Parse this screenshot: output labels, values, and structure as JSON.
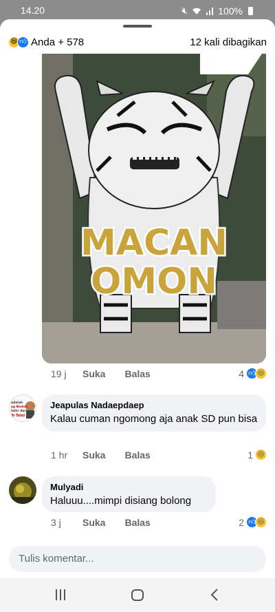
{
  "status": {
    "time": "14.20",
    "battery": "100%"
  },
  "post": {
    "reactors": "Anda + 578",
    "shares": "12 kali dibagikan",
    "meme_caption_line1": "MACAN",
    "meme_caption_line2": "OMON",
    "time": "19 j",
    "like_label": "Suka",
    "reply_label": "Balas",
    "reaction_count": "4"
  },
  "comments": [
    {
      "author": "Jeapulas Nadaepdaep",
      "text": "Kalau cuman ngomong aja anak SD  pun bisa",
      "time": "1 hr",
      "like_label": "Suka",
      "reply_label": "Balas",
      "reaction_count": "1",
      "avatar_text": "adalah\nyg Bodoh\nlahir dari\nih Tolol"
    },
    {
      "author": "Mulyadi",
      "text": "Haluuu....mimpi disiang bolong",
      "time": "3 j",
      "like_label": "Suka",
      "reply_label": "Balas",
      "reaction_count": "2"
    }
  ],
  "composer": {
    "placeholder": "Tulis komentar..."
  },
  "colors": {
    "accent": "#1877f2",
    "bubble": "#f0f2f5",
    "muted": "#65676b",
    "haha": "#f7c22a"
  },
  "icons": {
    "status": [
      "mute-icon",
      "wifi-icon",
      "signal-icon",
      "battery-icon"
    ],
    "reactions": [
      "haha-reaction-icon",
      "like-reaction-icon"
    ],
    "nav": [
      "recents-icon",
      "home-icon",
      "back-icon"
    ]
  }
}
